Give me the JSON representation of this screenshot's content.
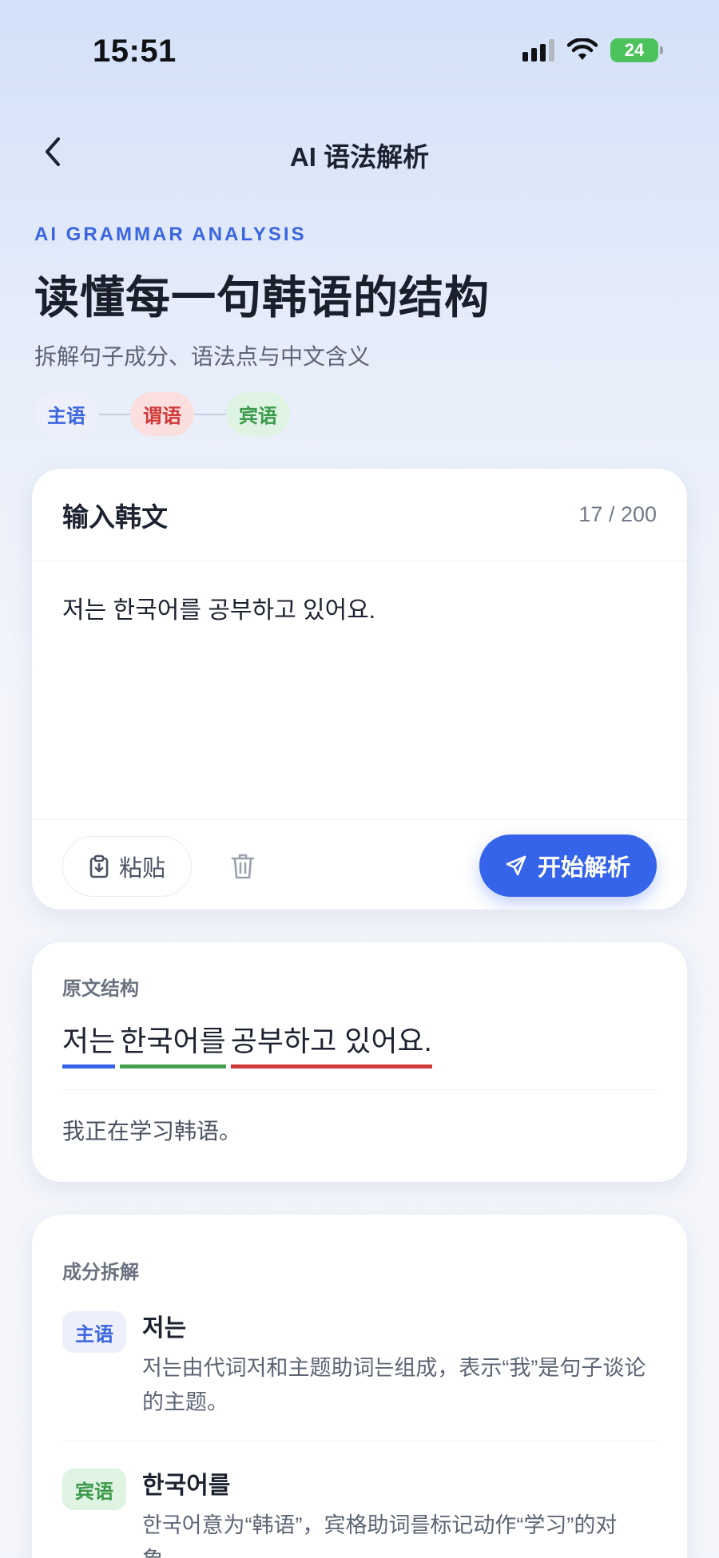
{
  "status_bar": {
    "time": "15:51",
    "battery": "24"
  },
  "nav": {
    "title": "AI 语法解析"
  },
  "hero": {
    "eyebrow": "AI GRAMMAR ANALYSIS",
    "title": "读懂每一句韩语的结构",
    "subtitle": "拆解句子成分、语法点与中文含义",
    "legend": [
      "主语",
      "谓语",
      "宾语"
    ]
  },
  "input_card": {
    "title": "输入韩文",
    "counter": "17 / 200",
    "value": "저는 한국어를 공부하고 있어요.",
    "paste_label": "粘贴",
    "start_label": "开始解析"
  },
  "structure_card": {
    "label": "原文结构",
    "segments": [
      "저는",
      "한국어를",
      "공부하고 있어요."
    ],
    "translation": "我正在学习韩语。"
  },
  "breakdown_card": {
    "label": "成分拆解",
    "items": [
      {
        "badge": "主语",
        "word": "저는",
        "desc": "저는由代词저和主题助词는组成，表示“我”是句子谈论的主题。"
      },
      {
        "badge": "宾语",
        "word": "한국어를",
        "desc": "한국어意为“韩语”，宾格助词를标记动作“学习”的对象。"
      }
    ]
  },
  "colors": {
    "accent": "#3563e9",
    "subject": "#3563e9",
    "object": "#43a04f",
    "predicate": "#d13a3a"
  }
}
